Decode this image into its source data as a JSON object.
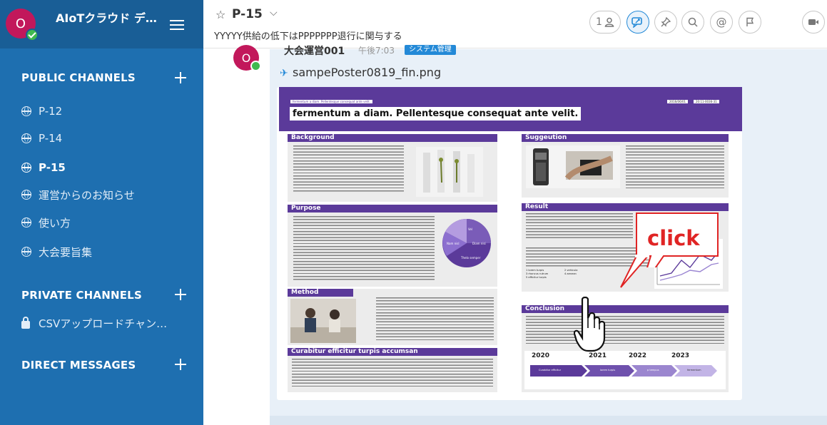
{
  "sidebar": {
    "team": {
      "avatar_letter": "O",
      "name": "AIoTクラウド デ…"
    },
    "public_channels": {
      "title": "PUBLIC CHANNELS",
      "items": [
        {
          "label": "P-12",
          "icon": "globe-icon",
          "active": false
        },
        {
          "label": "P-14",
          "icon": "globe-icon",
          "active": false
        },
        {
          "label": "P-15",
          "icon": "globe-icon",
          "active": true
        },
        {
          "label": "運営からのお知らせ",
          "icon": "globe-icon",
          "active": false
        },
        {
          "label": "使い方",
          "icon": "globe-icon",
          "active": false
        },
        {
          "label": "大会要旨集",
          "icon": "globe-icon",
          "active": false
        }
      ]
    },
    "private_channels": {
      "title": "PRIVATE CHANNELS",
      "items": [
        {
          "label": "CSVアップロードチャン…",
          "icon": "lock-icon"
        }
      ]
    },
    "direct_messages": {
      "title": "DIRECT MESSAGES"
    }
  },
  "header": {
    "channel_name": "P-15",
    "purpose": "YYYYY供給の低下はPPPPPPP退行に関与する",
    "member_count": "1",
    "buttons": [
      "member-icon",
      "pinned-messages-icon",
      "pin-icon",
      "search-icon",
      "mention-icon",
      "flag-icon",
      "video-icon"
    ]
  },
  "post": {
    "avatar_letter": "O",
    "author": "大会運営001",
    "time": "午後7:03",
    "badge": "システム管理",
    "attachment": {
      "filename": "sampePoster0819_fin.png"
    }
  },
  "poster": {
    "small_title": "fermentum a diam. Pellentesque consequat ante velit.",
    "title": "fermentum a diam. Pellentesque consequat ante velit.",
    "date": "2016/06/01",
    "time": "20:11-0036-31",
    "sections": {
      "background": "Background",
      "purpose": "Purpose",
      "method": "Method",
      "curabitur": "Curabitur efficitur turpis accumsan",
      "suggestion": "Suggeution",
      "result": "Result",
      "conclusion": "Conclusion"
    },
    "pie_labels": [
      "Vel",
      "Nam nisl",
      "Diam nisi",
      "Thelo semper"
    ],
    "timeline_years": [
      "2020",
      "2021",
      "2022",
      "2023"
    ],
    "timeline_steps": [
      "Curabitur efficitur",
      "lorem turpis",
      "p tempus",
      "fermentum"
    ],
    "result_list": [
      "1 lorem turpis",
      "2 vehicula",
      "3 rhoncus rutrum",
      "4 aenean",
      "5 efficitur turpis"
    ]
  },
  "annotation": {
    "callout_text": "click",
    "callout_color": "#e02424"
  },
  "colors": {
    "sidebar": "#1e6fb0",
    "sidebar_header": "#195e96",
    "poster_purple": "#5b3a9a",
    "accent": "#2389d7"
  }
}
